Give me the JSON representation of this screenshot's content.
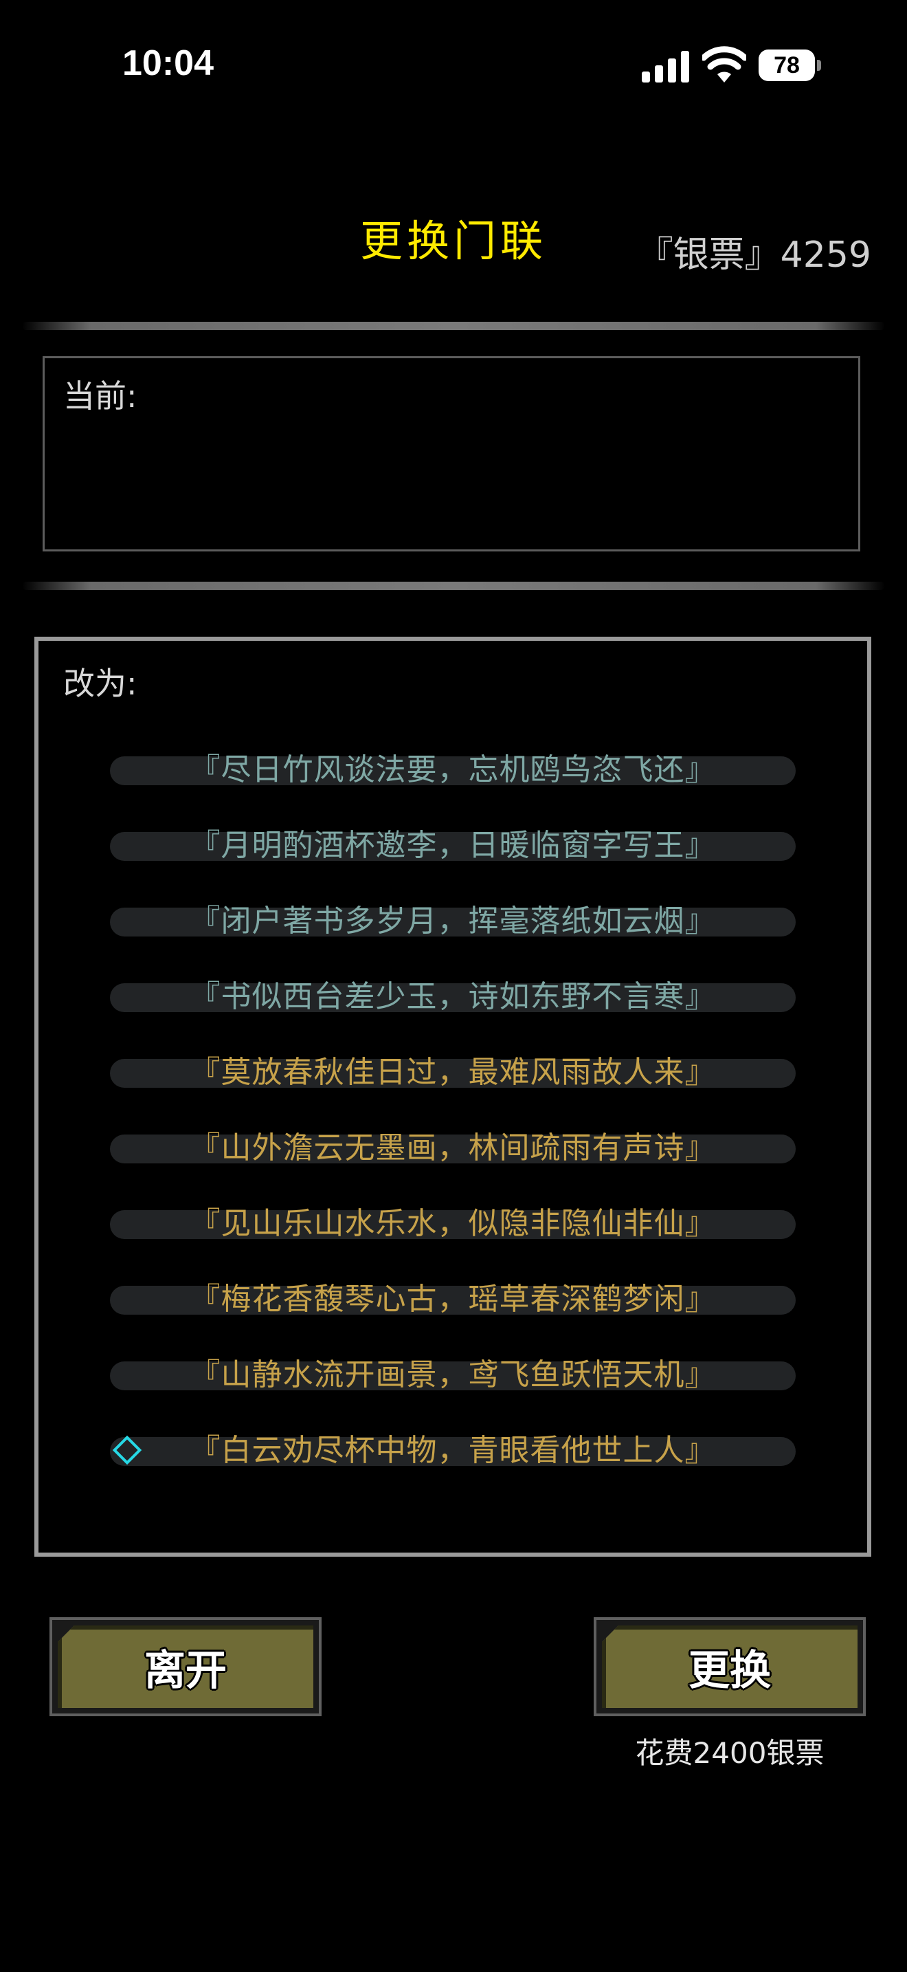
{
  "status_bar": {
    "time": "10:04",
    "battery": "78"
  },
  "header": {
    "title": "更换门联",
    "currency": "『银票』4259"
  },
  "current": {
    "label": "当前:"
  },
  "options": {
    "label": "改为:",
    "items": [
      {
        "text": "『尽日竹风谈法要，忘机鸥鸟恣飞还』",
        "color": "teal"
      },
      {
        "text": "『月明酌酒杯邀李，日暖临窗字写王』",
        "color": "teal"
      },
      {
        "text": "『闭户著书多岁月，挥毫落纸如云烟』",
        "color": "teal"
      },
      {
        "text": "『书似西台差少玉，诗如东野不言寒』",
        "color": "teal"
      },
      {
        "text": "『莫放春秋佳日过，最难风雨故人来』",
        "color": "gold"
      },
      {
        "text": "『山外澹云无墨画，林间疏雨有声诗』",
        "color": "gold"
      },
      {
        "text": "『见山乐山水乐水，似隐非隐仙非仙』",
        "color": "gold"
      },
      {
        "text": "『梅花香馥琴心古，瑶草春深鹤梦闲』",
        "color": "gold"
      },
      {
        "text": "『山静水流开画景，鸢飞鱼跃悟天机』",
        "color": "gold"
      },
      {
        "text": "『白云劝尽杯中物，青眼看他世上人』",
        "color": "gold",
        "selected": true
      }
    ]
  },
  "buttons": {
    "leave": "离开",
    "change": "更换",
    "cost": "花费2400银票"
  },
  "colors": {
    "title": "#ffea00",
    "teal": "#7fa8a5",
    "gold": "#c7a24a",
    "selector": "#26d9e6",
    "button_face": "#6f6b36"
  }
}
